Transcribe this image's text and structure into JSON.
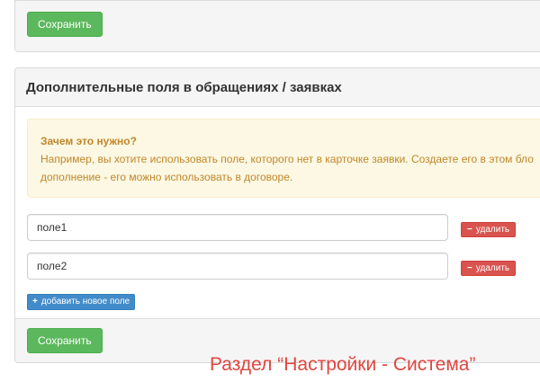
{
  "top_panel": {
    "save_label": "Сохранить"
  },
  "fields_panel": {
    "title": "Дополнительные поля в обращениях / заявках",
    "alert": {
      "title": "Зачем это нужно?",
      "text": "Например, вы хотите использовать поле, которого нет в карточке заявки. Создаете его в этом бло дополнение - его можно использовать в договоре."
    },
    "fields": [
      {
        "value": "поле1",
        "delete_label": "удалить",
        "delete_icon": "minus-icon"
      },
      {
        "value": "поле2",
        "delete_label": "удалить",
        "delete_icon": "minus-icon"
      }
    ],
    "add_label": "добавить новое поле",
    "add_icon": "plus-icon",
    "save_label": "Сохранить"
  },
  "caption": "Раздел “Настройки - Система”",
  "colors": {
    "save_button": "#5cb85c",
    "delete_button": "#d9534f",
    "add_button": "#428bca",
    "alert_bg": "#fcf8e3",
    "alert_text": "#c0862b",
    "caption": "#e0453f"
  }
}
